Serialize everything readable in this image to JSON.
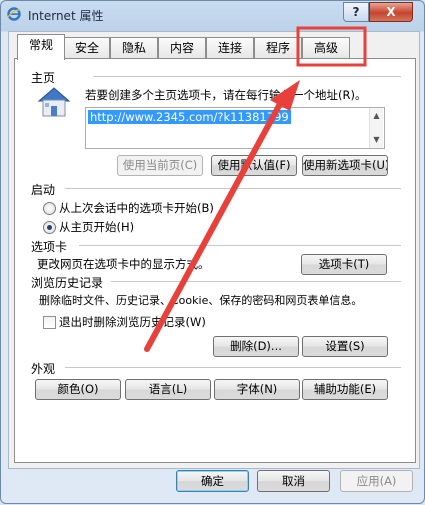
{
  "window": {
    "title": "Internet 属性",
    "help_label": "?",
    "close_label": "X"
  },
  "tabs": [
    {
      "label": "常规",
      "active": true
    },
    {
      "label": "安全"
    },
    {
      "label": "隐私"
    },
    {
      "label": "内容"
    },
    {
      "label": "连接"
    },
    {
      "label": "程序"
    },
    {
      "label": "高级"
    }
  ],
  "home_page": {
    "title": "主页",
    "description": "若要创建多个主页选项卡，请在每行输入一个地址(R)。",
    "url": "http://www.2345.com/?k11381799",
    "use_current_label": "使用当前页(C)",
    "use_default_label": "使用默认值(F)",
    "use_new_tab_label": "使用新选项卡(U)"
  },
  "startup": {
    "title": "启动",
    "option_last_session": "从上次会话中的选项卡开始(B)",
    "option_home_page": "从主页开始(H)",
    "selected": "home_page"
  },
  "tabs_section": {
    "title": "选项卡",
    "description": "更改网页在选项卡中的显示方式。",
    "button_label": "选项卡(T)"
  },
  "history": {
    "title": "浏览历史记录",
    "description": "删除临时文件、历史记录、Cookie、保存的密码和网页表单信息。",
    "delete_on_exit_label": "退出时删除浏览历史记录(W)",
    "delete_on_exit_checked": false,
    "delete_label": "删除(D)...",
    "settings_label": "设置(S)"
  },
  "appearance": {
    "title": "外观",
    "colors_label": "颜色(O)",
    "languages_label": "语言(L)",
    "fonts_label": "字体(N)",
    "accessibility_label": "辅助功能(E)"
  },
  "footer": {
    "ok_label": "确定",
    "cancel_label": "取消",
    "apply_label": "应用(A)"
  },
  "annotation": {
    "highlight_color": "#e8403a",
    "arrow_color": "#e8403a"
  }
}
